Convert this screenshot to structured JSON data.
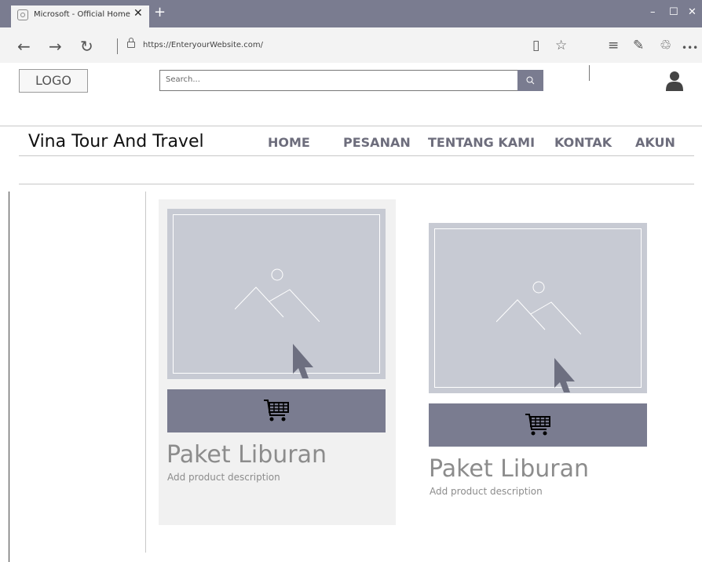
{
  "browser": {
    "tab_title": "Microsoft - Official Home",
    "tab_close": "✕",
    "new_tab": "+",
    "window_controls": {
      "minimize": "–",
      "maximize": "☐",
      "close": "✕"
    },
    "url": "https://EnteryourWebsite.com/",
    "nav": {
      "back": "←",
      "forward": "→",
      "refresh": "↻"
    },
    "toolbar_icons": [
      "reading-view-icon",
      "favorite-star-icon",
      "hub-icon",
      "web-note-icon",
      "share-icon",
      "more-icon"
    ],
    "toolbar_glyphs": {
      "reading": "▯",
      "star": "☆",
      "hub": "≡",
      "note": "✎",
      "share": "♲",
      "more": "•••"
    }
  },
  "header": {
    "logo": "LOGO",
    "search_placeholder": "Search...",
    "user_icon": "user-icon"
  },
  "site": {
    "brand": "Vina Tour And Travel",
    "menu": [
      "HOME",
      "PESANAN",
      "TENTANG KAMI",
      "KONTAK",
      "AKUN"
    ]
  },
  "products": [
    {
      "title": "Paket Liburan",
      "description": "Add product description",
      "icon": "shopping-cart-icon"
    },
    {
      "title": "Paket Liburan",
      "description": "Add product description",
      "icon": "shopping-cart-icon"
    }
  ],
  "colors": {
    "accent": "#7a7c90",
    "placeholder": "#c7cad3",
    "card": "#f1f1f1"
  }
}
